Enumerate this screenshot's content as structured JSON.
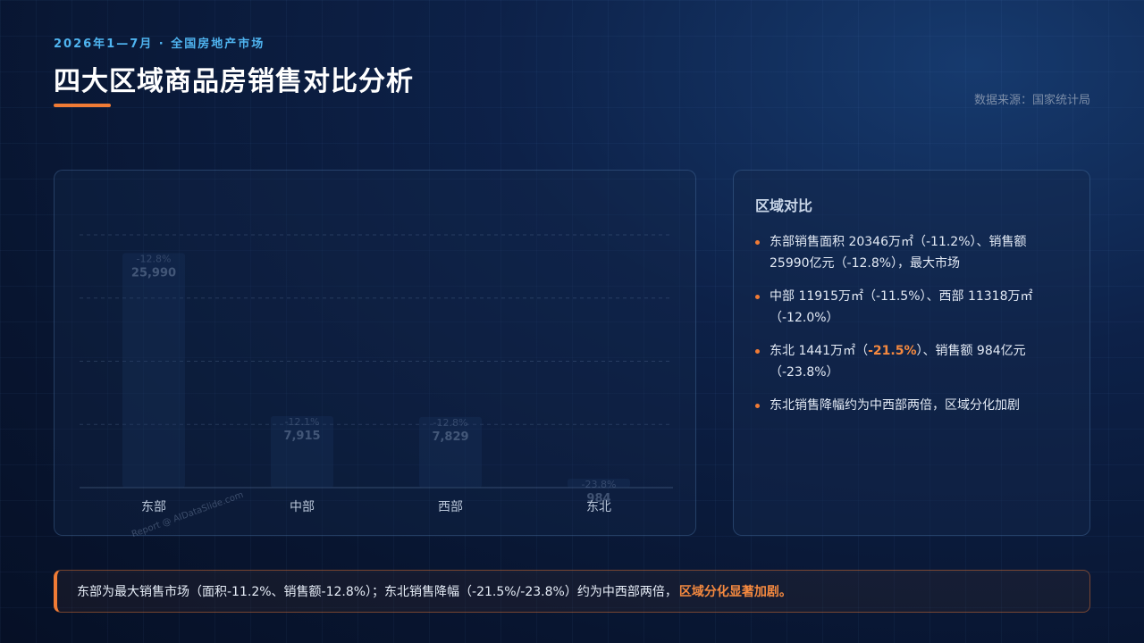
{
  "header": {
    "subtitle": "2026年1—7月 · 全国房地产市场",
    "title": "四大区域商品房销售对比分析",
    "source": "数据来源：国家统计局"
  },
  "watermark": "Report @ AIDataSlide.com",
  "chart_data": {
    "type": "bar",
    "categories": [
      "东部",
      "中部",
      "西部",
      "东北"
    ],
    "values": [
      25990,
      7915,
      7829,
      984
    ],
    "value_labels": [
      "25,990",
      "7,915",
      "7,829",
      "984"
    ],
    "change_labels": [
      "-12.8%",
      "-12.1%",
      "-12.8%",
      "-23.8%"
    ],
    "ylim": [
      0,
      28000
    ],
    "grid": true,
    "bar_color": "#1e3a66"
  },
  "side": {
    "heading": "区域对比",
    "bullets": [
      {
        "text": "东部销售面积 20346万㎡（-11.2%）、销售额 25990亿元（-12.8%），最大市场"
      },
      {
        "text": "中部 11915万㎡（-11.5%）、西部 11318万㎡（-12.0%）"
      },
      {
        "pre": "东北 1441万㎡（",
        "hl": "-21.5%",
        "post": "）、销售额 984亿元（-23.8%）"
      },
      {
        "text": "东北销售降幅约为中西部两倍，区域分化加剧"
      }
    ]
  },
  "bottom": {
    "text": "东部为最大销售市场（面积-11.2%、销售额-12.8%）；东北销售降幅（-21.5%/-23.8%）约为中西部两倍，",
    "highlight": "区域分化显著加剧。"
  },
  "colors": {
    "accent": "#f07b35",
    "subtitle": "#4fb4f0"
  }
}
